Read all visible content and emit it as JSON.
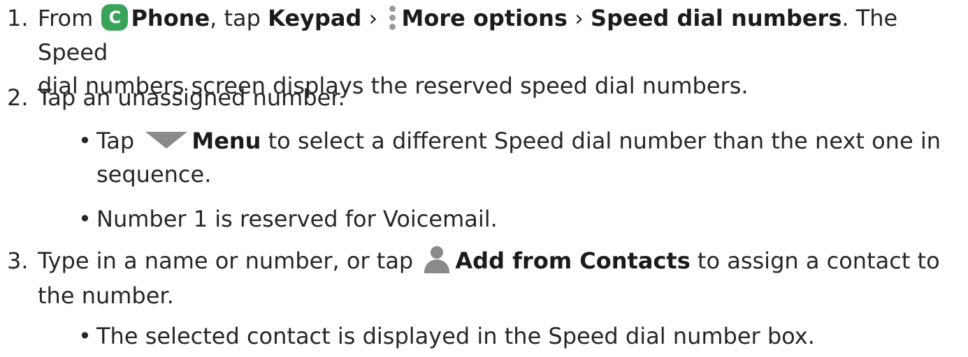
{
  "steps": [
    {
      "number": "1.",
      "from": "From",
      "phone_label": "Phone",
      "phone_icon_glyph": "C",
      "tap": ", tap",
      "keypad_label": "Keypad",
      "sep1": "›",
      "more_options_label": "More options",
      "sep2": "›",
      "speed_dial_label": "Speed dial numbers",
      "line1_rest": ". The Speed",
      "line2": "dial numbers screen displays the reserved speed dial numbers."
    },
    {
      "number": "2.",
      "text": "Tap an unassigned number.",
      "bullets": [
        {
          "tap": "Tap",
          "menu_label": "Menu",
          "rest_line1": "to select a different Speed dial number than the next one in",
          "rest_line2": "sequence."
        },
        {
          "text": "Number 1 is reserved for Voicemail."
        }
      ]
    },
    {
      "number": "3.",
      "pre": "Type in a name or number, or tap",
      "add_label": "Add from Contacts",
      "post": "to assign a contact to",
      "line2": "the number.",
      "bullets": [
        {
          "text": "The selected contact is displayed in the Speed dial number box."
        }
      ]
    }
  ],
  "bullet_glyph": "•",
  "icons": {
    "phone": "phone-app-icon",
    "more_options": "more-options-icon",
    "menu": "dropdown-triangle-icon",
    "contacts": "person-icon"
  },
  "colors": {
    "phone_icon": "#3aa35a",
    "icon_gray": "#8a8a8a",
    "text": "#262626"
  }
}
